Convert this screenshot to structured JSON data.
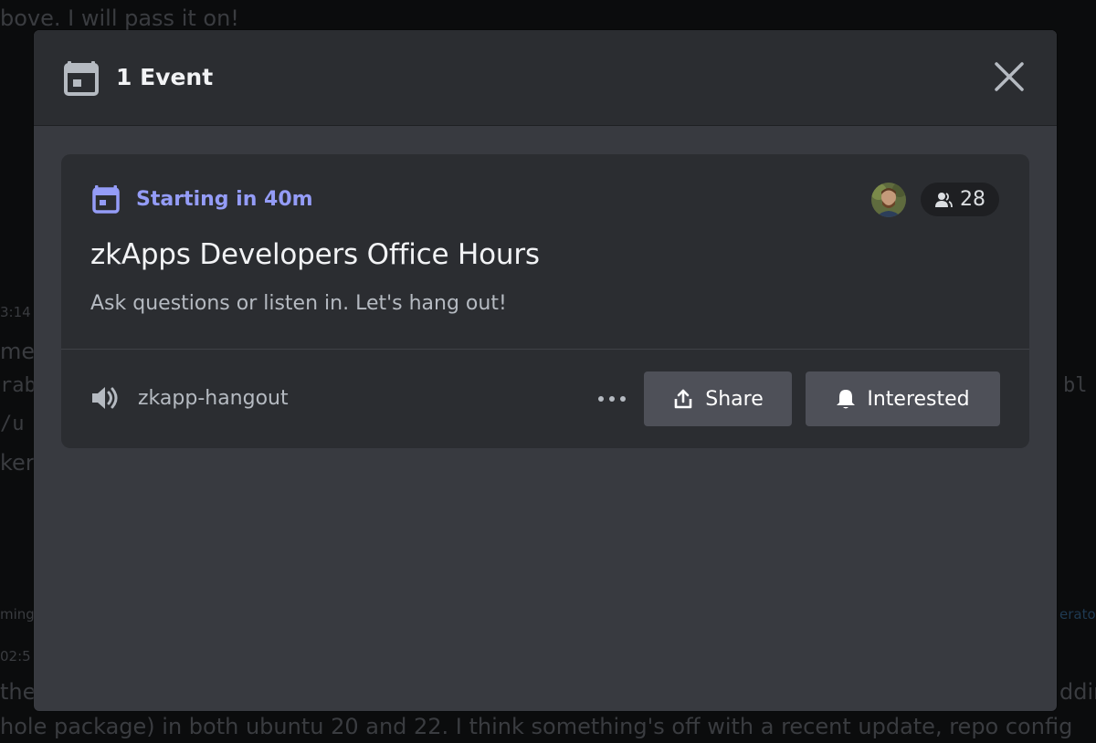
{
  "background": {
    "lines": [
      "bove. I will pass it on!",
      "3:14",
      "me",
      "rab",
      "/u",
      "ker",
      "bl",
      "ming",
      "erato",
      "02:5",
      "the",
      "ddin",
      "hole package) in both ubuntu 20 and 22. I think something's off with a recent update, repo config"
    ]
  },
  "modal": {
    "title": "1 Event",
    "close_icon": "close-icon",
    "header_icon": "calendar-icon"
  },
  "event": {
    "starting": "Starting in 40m",
    "interested_count": "28",
    "title": "zkApps Developers Office Hours",
    "description": "Ask questions or listen in. Let's hang out!",
    "channel": "zkapp-hangout",
    "share_label": "Share",
    "interested_label": "Interested"
  },
  "colors": {
    "accent": "#949cf7",
    "modal_bg": "#383a40",
    "header_bg": "#2b2d31",
    "card_bg": "#2b2d31",
    "button_bg": "#4e5058"
  }
}
